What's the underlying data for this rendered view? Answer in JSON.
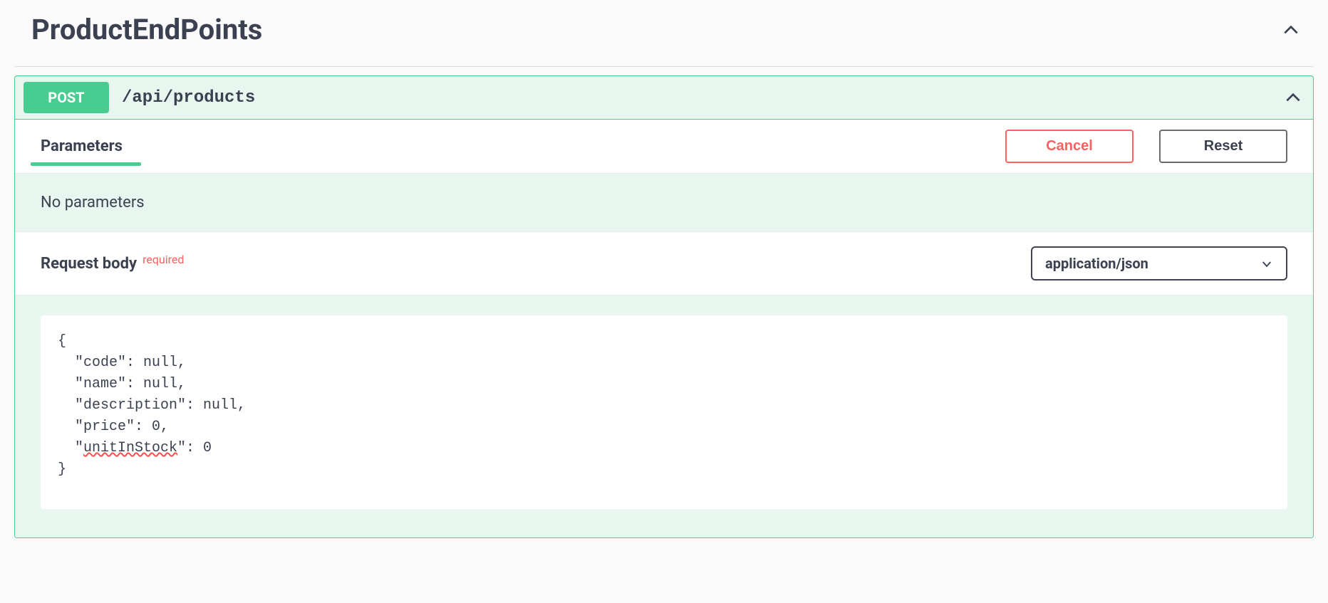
{
  "section": {
    "title": "ProductEndPoints"
  },
  "operation": {
    "method": "POST",
    "path": "/api/products",
    "expanded": true
  },
  "parameters": {
    "tab_label": "Parameters",
    "cancel_label": "Cancel",
    "reset_label": "Reset",
    "empty_text": "No parameters"
  },
  "request_body": {
    "label": "Request body",
    "required_tag": "required",
    "content_type": "application/json",
    "example_lines": [
      "{",
      "  \"code\": null,",
      "  \"name\": null,",
      "  \"description\": null,",
      "  \"price\": 0,",
      "  \"unitInStock\": 0",
      "}"
    ],
    "example_schema": {
      "code": null,
      "name": null,
      "description": null,
      "price": 0,
      "unitInStock": 0
    }
  },
  "colors": {
    "accent_post": "#49cc90",
    "danger": "#ff6060",
    "text": "#3b4151"
  }
}
